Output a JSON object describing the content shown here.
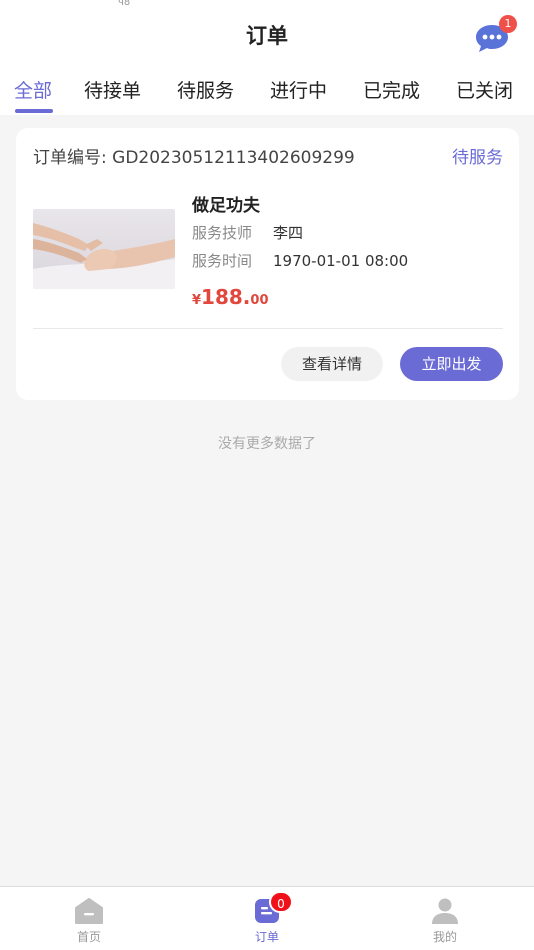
{
  "status_bar": {
    "fragment": "ч8"
  },
  "header": {
    "title": "订单",
    "message_badge": "1",
    "message_icon": "chat-bubble-icon"
  },
  "tabs": [
    {
      "label": "全部",
      "active": true
    },
    {
      "label": "待接单",
      "active": false
    },
    {
      "label": "待服务",
      "active": false
    },
    {
      "label": "进行中",
      "active": false
    },
    {
      "label": "已完成",
      "active": false
    },
    {
      "label": "已关闭",
      "active": false
    }
  ],
  "order": {
    "number_label": "订单编号:",
    "number": "GD20230512113402609299",
    "status": "待服务",
    "service_name": "做足功夫",
    "technician_label": "服务技师",
    "technician": "李四",
    "time_label": "服务时间",
    "time": "1970-01-01 08:00",
    "price_symbol": "¥",
    "price_integer": "188.",
    "price_decimal": "00",
    "detail_button": "查看详情",
    "depart_button": "立即出发"
  },
  "list_footer": "没有更多数据了",
  "tabbar": {
    "items": [
      {
        "label": "首页",
        "icon": "home-icon",
        "active": false
      },
      {
        "label": "订单",
        "icon": "order-icon",
        "active": true,
        "badge": "0"
      },
      {
        "label": "我的",
        "icon": "user-icon",
        "active": false
      }
    ]
  },
  "colors": {
    "accent": "#6a6bd4",
    "price": "#e2473d",
    "badge": "#f0504a",
    "background": "#f5f5f5"
  }
}
